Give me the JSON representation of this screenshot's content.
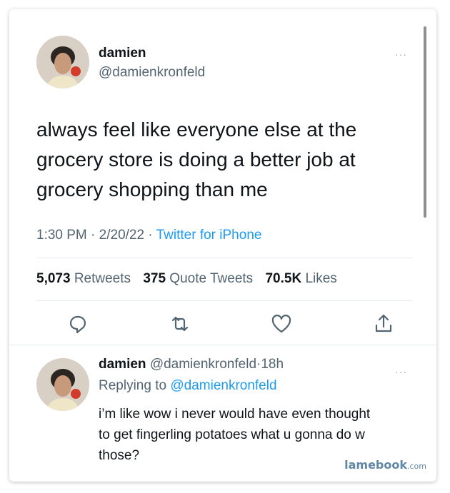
{
  "tweet": {
    "author_name": "damien",
    "author_handle": "@damienkronfeld",
    "text": "always feel like everyone else at the grocery store is doing a better job at grocery shopping than me",
    "time": "1:30 PM",
    "date": "2/20/22",
    "source": "Twitter for iPhone",
    "separator": "·",
    "retweets_count": "5,073",
    "retweets_label": "Retweets",
    "quote_count": "375",
    "quote_label": "Quote Tweets",
    "likes_count": "70.5K",
    "likes_label": "Likes",
    "more_label": "···"
  },
  "actions": [
    "reply-icon",
    "retweet-icon",
    "like-icon",
    "share-icon"
  ],
  "reply": {
    "author_name": "damien",
    "author_handle": "@damienkronfeld",
    "age": "18h",
    "replying_prefix": "Replying to",
    "replying_to": "@damienkronfeld",
    "text": "i’m like wow i never would have even thought to get fingerling potatoes what u gonna do w those?",
    "more_label": "···"
  },
  "watermark": {
    "brand": "lamebook",
    "domain": ".com"
  },
  "colors": {
    "link": "#1d9bf0",
    "muted": "#536471",
    "text": "#0f1419"
  }
}
